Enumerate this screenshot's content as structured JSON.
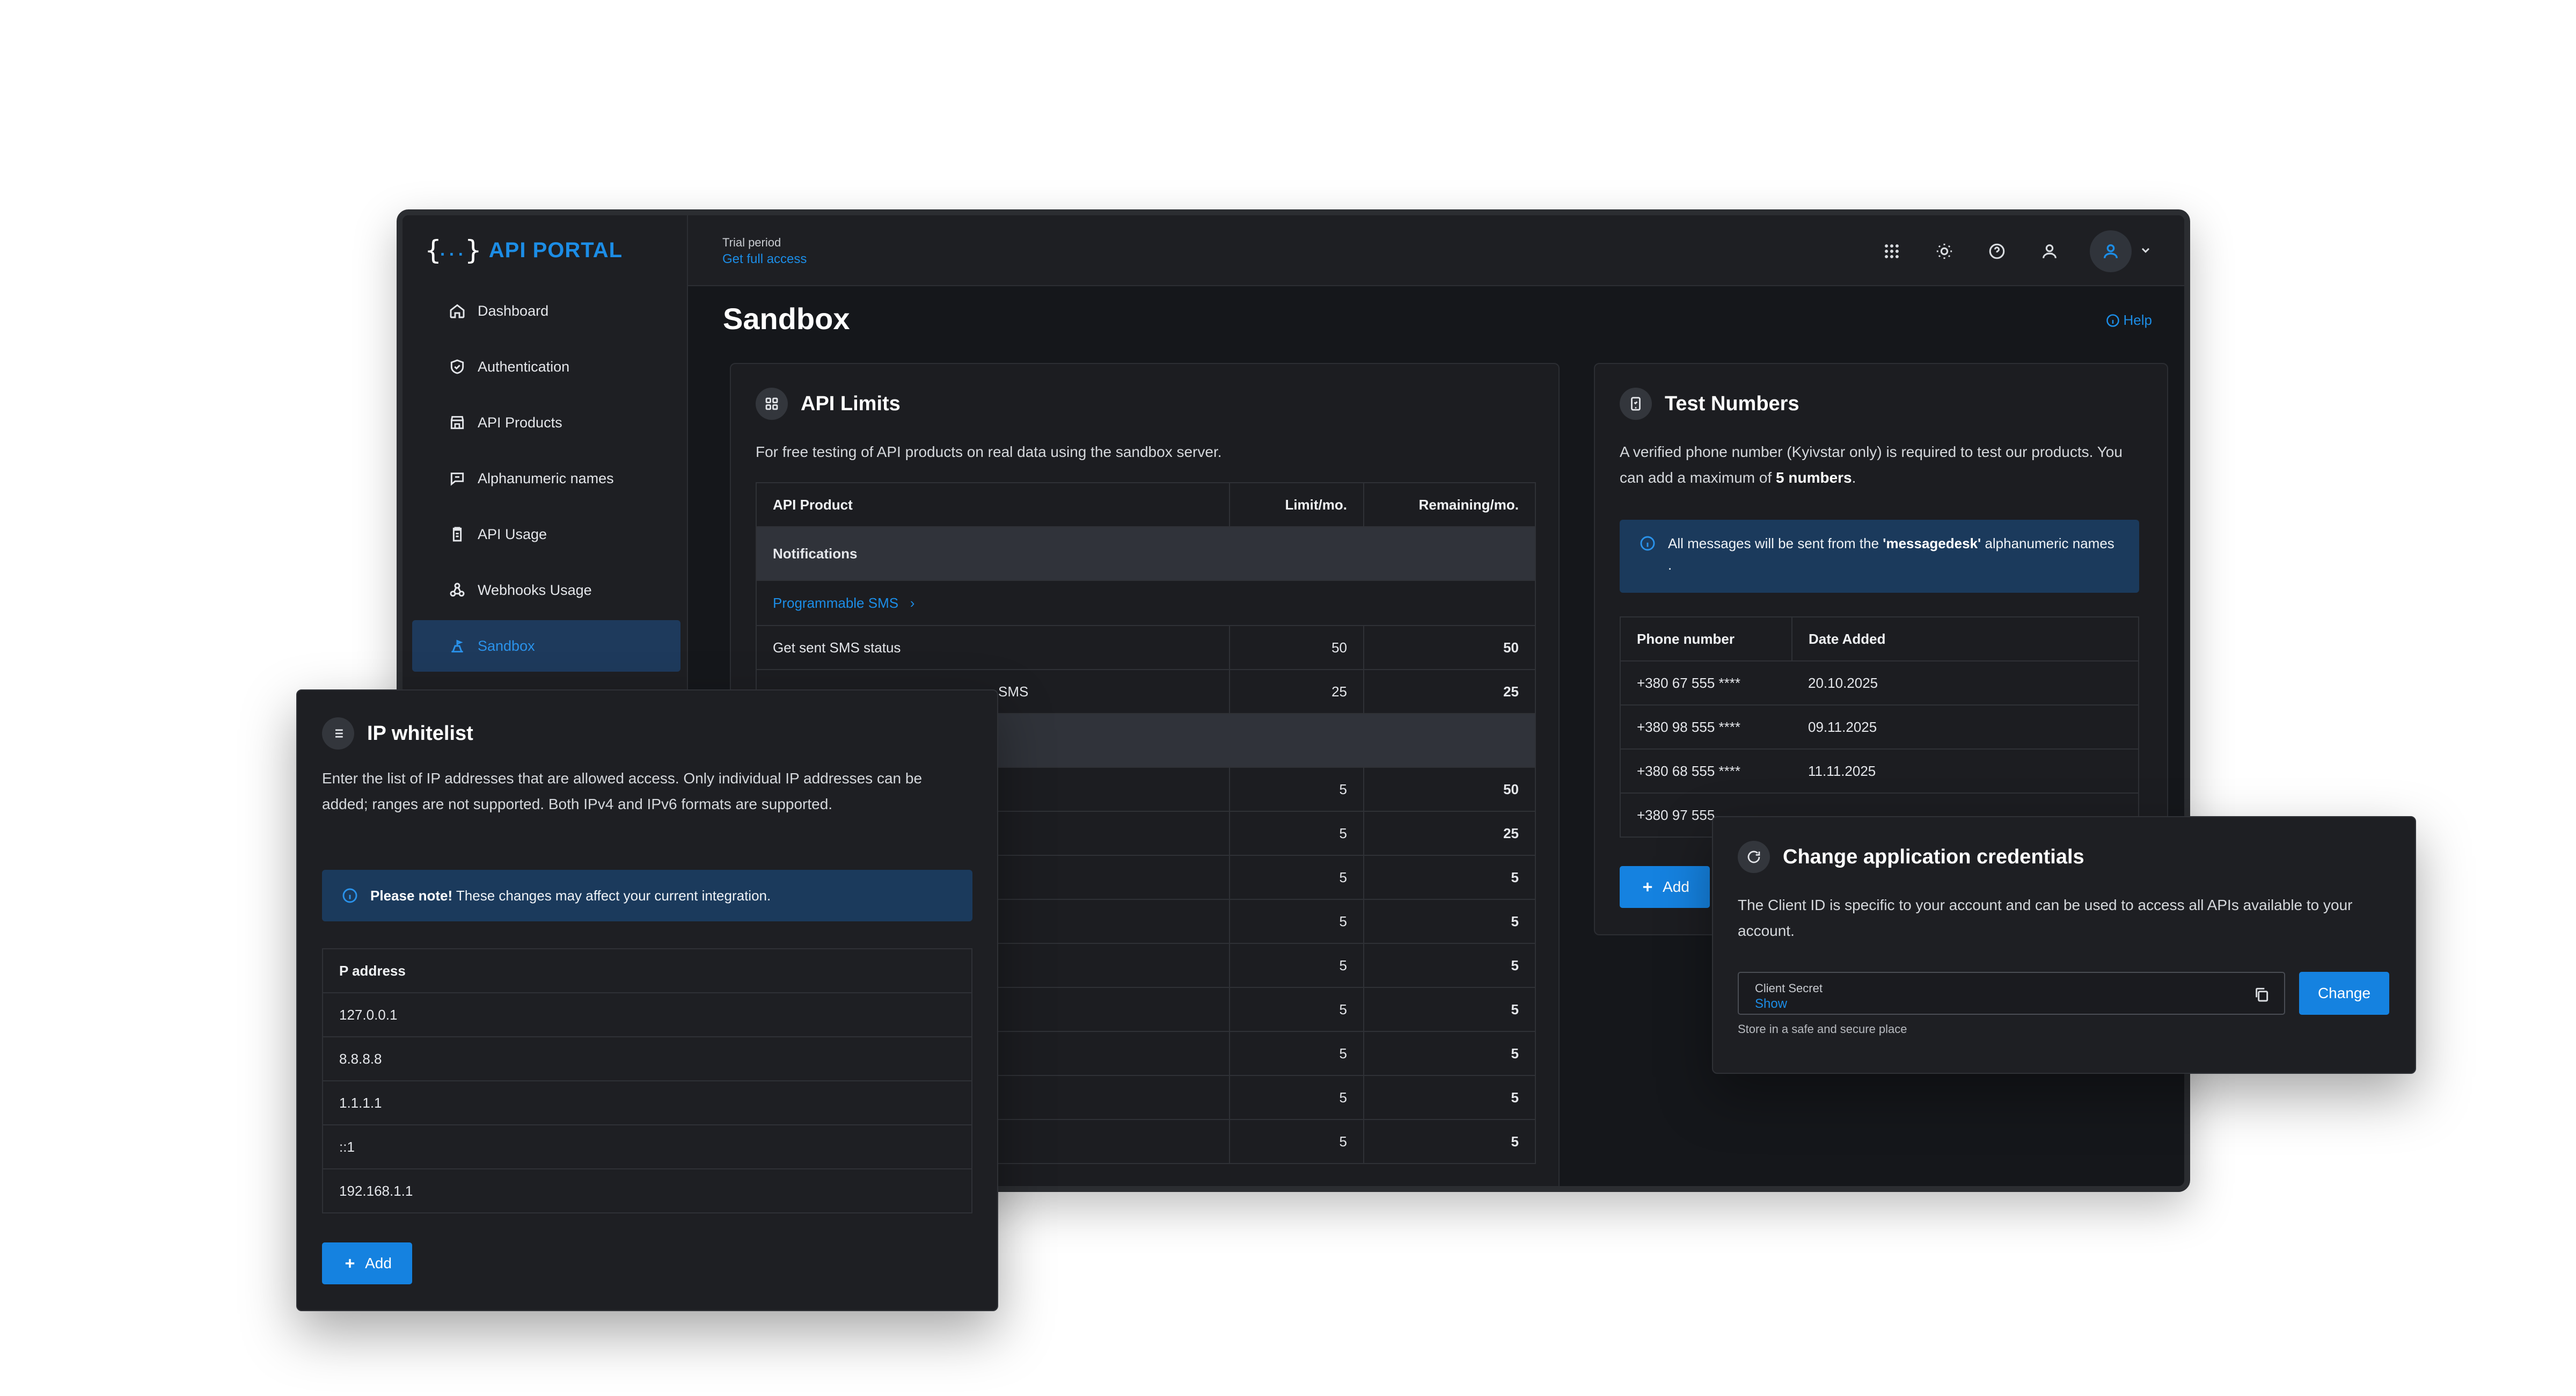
{
  "app": {
    "brand": "API PORTAL"
  },
  "sidebar": {
    "items": [
      {
        "label": "Dashboard",
        "icon": "home-icon"
      },
      {
        "label": "Authentication",
        "icon": "shield-icon"
      },
      {
        "label": "API Products",
        "icon": "store-icon"
      },
      {
        "label": "Alphanumeric names",
        "icon": "chat-icon"
      },
      {
        "label": "API Usage",
        "icon": "clipboard-icon"
      },
      {
        "label": "Webhooks Usage",
        "icon": "webhook-icon"
      },
      {
        "label": "Sandbox",
        "icon": "sandbox-icon",
        "active": true
      }
    ]
  },
  "topbar": {
    "trial_label": "Trial period",
    "trial_link": "Get full access",
    "icons": [
      "apps-grid-icon",
      "sun-icon",
      "help-circle-icon",
      "user-switch-icon",
      "user-icon",
      "chevron-down-icon"
    ]
  },
  "page": {
    "title": "Sandbox",
    "help": "Help"
  },
  "api_limits": {
    "title": "API Limits",
    "description": "For free testing of API products on real data using the sandbox server.",
    "columns": [
      "API Product",
      "Limit/mo.",
      "Remaining/mo."
    ],
    "group": "Notifications",
    "product": "Programmable SMS",
    "rows": [
      {
        "name": "Get sent SMS status",
        "limit": "50",
        "remaining": "50"
      },
      {
        "name": "SMS",
        "limit": "25",
        "remaining": "25"
      }
    ],
    "hidden_rows": [
      {
        "limit": "5",
        "remaining": "50"
      },
      {
        "limit": "5",
        "remaining": "25"
      },
      {
        "limit": "5",
        "remaining": "5"
      },
      {
        "limit": "5",
        "remaining": "5"
      },
      {
        "limit": "5",
        "remaining": "5"
      },
      {
        "limit": "5",
        "remaining": "5"
      },
      {
        "limit": "5",
        "remaining": "5"
      },
      {
        "limit": "5",
        "remaining": "5"
      },
      {
        "limit": "5",
        "remaining": "5"
      }
    ]
  },
  "test_numbers": {
    "title": "Test Numbers",
    "desc_part1": "A verified phone number (Kyivstar only) is required to test our products. You can add a maximum of ",
    "desc_bold": "5 numbers",
    "desc_part2": ".",
    "note_part1": "All messages will be sent from the ",
    "note_bold": "'messagedesk'",
    "note_part2": " alphanumeric names .",
    "columns": [
      "Phone number",
      "Date Added"
    ],
    "rows": [
      {
        "phone": "+380 67 555 ****",
        "date": "20.10.2025"
      },
      {
        "phone": "+380 98 555 ****",
        "date": "09.11.2025"
      },
      {
        "phone": "+380 68 555 ****",
        "date": "11.11.2025"
      },
      {
        "phone": "+380 97 555",
        "date": ""
      }
    ],
    "add_label": "Add"
  },
  "ip_whitelist": {
    "title": "IP whitelist",
    "description": "Enter the list of IP addresses that are allowed access. Only individual IP addresses can be added; ranges are not supported. Both IPv4 and IPv6 formats are supported.",
    "note_bold": "Please note!",
    "note_text": " These changes may affect your current integration.",
    "column": "P address",
    "rows": [
      "127.0.0.1",
      "8.8.8.8",
      "1.1.1.1",
      "::1",
      "192.168.1.1"
    ],
    "add_label": "Add"
  },
  "credentials": {
    "title": "Change application credentials",
    "description": "The Client ID is specific to your account and can be used to access all APIs available to your account.",
    "field_label": "Client Secret",
    "field_value": "Show",
    "hint": "Store in a safe and secure place",
    "change_label": "Change"
  },
  "colors": {
    "accent": "#1c8de6",
    "background": "#15171b",
    "panel": "#1e1f23"
  }
}
